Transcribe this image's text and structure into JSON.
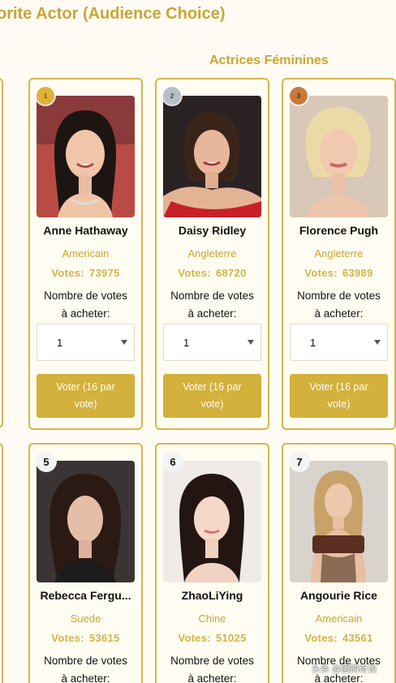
{
  "page_title": "orite Actor (Audience Choice)",
  "section_title": "Actrices Féminines",
  "watermark": "头条 @国韵奇谈",
  "labels": {
    "votes_label": "Votes:",
    "buy_line1": "Nombre de votes",
    "buy_line2": "à acheter:",
    "vote_button_line1": "Voter (16 par",
    "vote_button_line2": "vote)"
  },
  "colors": {
    "accent_gold": "#c9a635",
    "button_gold": "#d4b03c",
    "card_border": "#d7b64c",
    "medal_gold": "#e0b23a",
    "medal_silver": "#b8bfc8",
    "medal_bronze": "#c87a3a"
  },
  "cards": [
    {
      "rank": "1",
      "medal": "gold",
      "name": "Anne Hathaway",
      "country": "Americain",
      "votes": "73975",
      "qty": "1"
    },
    {
      "rank": "2",
      "medal": "silver",
      "name": "Daisy Ridley",
      "country": "Angleterre",
      "votes": "68720",
      "qty": "1"
    },
    {
      "rank": "3",
      "medal": "bronze",
      "name": "Florence Pugh",
      "country": "Angleterre",
      "votes": "63989",
      "qty": "1"
    },
    {
      "rank": "5",
      "medal": "none",
      "name": "Rebecca Fergu...",
      "country": "Suede",
      "votes": "53615"
    },
    {
      "rank": "6",
      "medal": "none",
      "name": "ZhaoLiYing",
      "country": "Chine",
      "votes": "51025"
    },
    {
      "rank": "7",
      "medal": "none",
      "name": "Angourie Rice",
      "country": "Americain",
      "votes": "43561"
    }
  ]
}
